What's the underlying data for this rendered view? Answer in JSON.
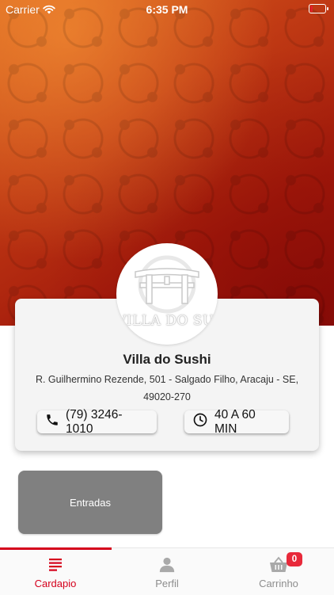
{
  "status_bar": {
    "carrier": "Carrier",
    "time": "6:35 PM",
    "battery_level": 0.15,
    "battery_color": "#e0202a"
  },
  "restaurant": {
    "logo_text": "VILLA DO SUSHI",
    "name": "Villa do Sushi",
    "address": "R. Guilhermino Rezende, 501 - Salgado Filho, Aracaju - SE, 49020-270",
    "phone": "(79) 3246-1010",
    "delivery_time": "40 A 60 MIN"
  },
  "categories": [
    {
      "label": "Entradas"
    }
  ],
  "tab_bar": {
    "tabs": [
      {
        "label": "Cardapio",
        "icon": "menu-lines-icon",
        "active": true
      },
      {
        "label": "Perfil",
        "icon": "person-icon",
        "active": false
      },
      {
        "label": "Carrinho",
        "icon": "basket-icon",
        "active": false
      }
    ],
    "cart_count": "0",
    "accent_color": "#d5001c"
  }
}
